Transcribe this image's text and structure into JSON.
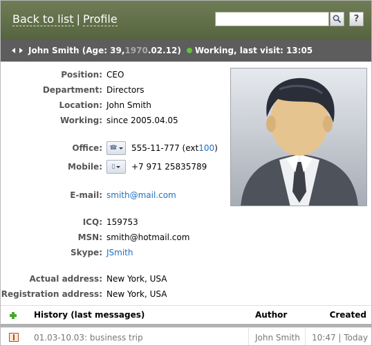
{
  "header": {
    "back_label": "Back to list",
    "separator": "|",
    "profile_label": "Profile",
    "search_value": "",
    "search_button_icon": "magnifier-icon",
    "help_label": "?"
  },
  "title": {
    "name": "John Smith",
    "age_prefix": "(Age: 39, ",
    "birth_year": "1970",
    "birth_rest": ".02.12)",
    "status_text": "Working, last visit: 13:05",
    "status_color": "#64c13a"
  },
  "profile": {
    "position_label": "Position:",
    "position": "CEO",
    "department_label": "Department:",
    "department": "Directors",
    "location_label": "Location:",
    "location": "John Smith",
    "working_label": "Working:",
    "working": "since 2005.04.05",
    "office_label": "Office:",
    "office_phone": "555-11-777 (ext ",
    "office_ext": "100",
    "office_close": ")",
    "mobile_label": "Mobile:",
    "mobile": "+7 971 25835789",
    "email_label": "E-mail:",
    "email": "smith@mail.com",
    "icq_label": "ICQ:",
    "icq": "159753",
    "msn_label": "MSN:",
    "msn": "smith@hotmail.com",
    "skype_label": "Skype:",
    "skype": "JSmith",
    "actual_address_label": "Actual address:",
    "actual_address": "New York, USA",
    "registration_address_label": "Registration address:",
    "registration_address": "New York, USA"
  },
  "history": {
    "header_title": "History (last messages)",
    "header_author": "Author",
    "header_created": "Created",
    "rows": [
      {
        "title": "01.03-10.03: business trip",
        "author": "John Smith",
        "created": "10:47 | Today"
      }
    ]
  },
  "colors": {
    "header_bg": "#5f6d48",
    "titlebar_bg": "#5d5d5d",
    "link": "#1e6fbf"
  }
}
